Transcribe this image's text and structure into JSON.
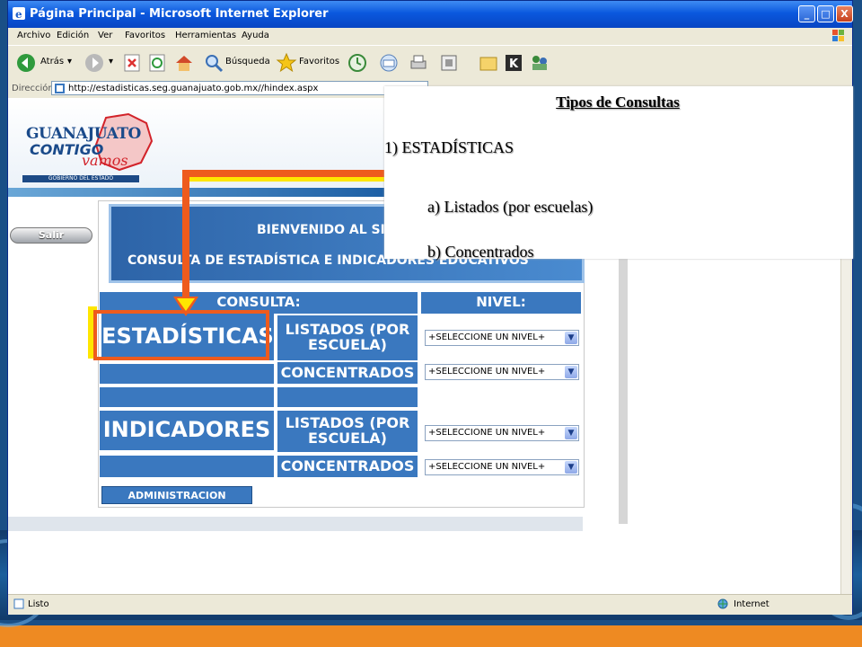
{
  "window": {
    "title": "Página Principal - Microsoft Internet Explorer",
    "buttons": [
      "_",
      "□",
      "X"
    ]
  },
  "menubar": {
    "items": [
      "Archivo",
      "Edición",
      "Ver",
      "Favoritos",
      "Herramientas",
      "Ayuda"
    ]
  },
  "toolbar": {
    "back_label": "Atrás",
    "search_label": "Búsqueda",
    "favorites_label": "Favoritos"
  },
  "addressbar": {
    "label": "Dirección",
    "url": "http://estadisticas.seg.guanajuato.gob.mx//hindex.aspx"
  },
  "site": {
    "logo_line1": "GUANAJUATO",
    "logo_line2": "CONTIGO",
    "logo_line3": "vamos",
    "logo_gov": "GOBIERNO DEL ESTADO",
    "salir_label": "Salir",
    "banner_line1": "BIENVENIDO AL SIS",
    "banner_line2": "CONSULTA DE ESTADÍSTICA E INDICADORES EDUCATIVOS",
    "header_consulta": "CONSULTA:",
    "header_nivel": "NIVEL:",
    "estadisticas": "ESTADÍSTICAS",
    "indicadores": "INDICADORES",
    "listados": "LISTADOS (POR ESCUELA)",
    "concentrados": "CONCENTRADOS",
    "select_placeholder": "+SELECCIONE UN NIVEL+",
    "admin_label": "ADMINISTRACION"
  },
  "statusbar": {
    "status": "Listo",
    "zone": "Internet"
  },
  "overlay": {
    "title": "Tipos de Consultas",
    "item1": "1)   ESTADÍSTICAS",
    "item1a": "a)   Listados (por escuelas)",
    "item1b": "b)   Concentrados"
  },
  "colors": {
    "accent_blue": "#3a78bf",
    "highlight_orange": "#ee5b1d",
    "highlight_yellow": "#ffe600",
    "titlebar_blue": "#0a58de"
  }
}
